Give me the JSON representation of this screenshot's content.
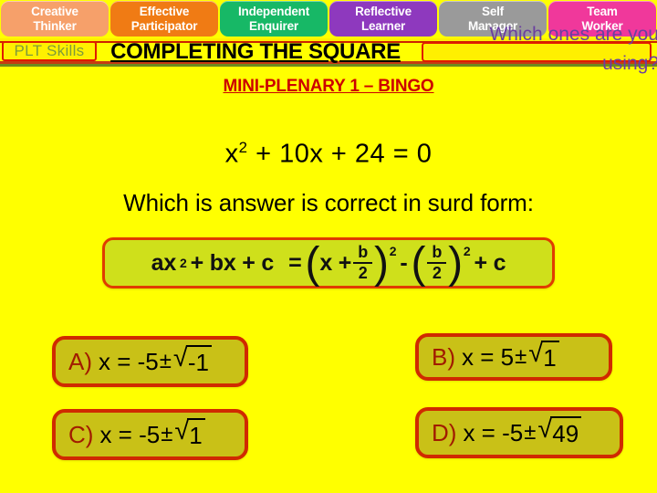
{
  "plt_bar": {
    "tabs": [
      {
        "label_line1": "Creative",
        "label_line2": "Thinker",
        "color": "#F6A06A"
      },
      {
        "label_line1": "Effective",
        "label_line2": "Participator",
        "color": "#F07B14"
      },
      {
        "label_line1": "Independent",
        "label_line2": "Enquirer",
        "color": "#17B866"
      },
      {
        "label_line1": "Reflective",
        "label_line2": "Learner",
        "color": "#8E39BE"
      },
      {
        "label_line1": "Self",
        "label_line2": "Manager",
        "color": "#9A9A9A"
      },
      {
        "label_line1": "Team",
        "label_line2": "Worker",
        "color": "#F0389B"
      }
    ]
  },
  "plt_skills": {
    "label": "PLT Skills",
    "border_color": "#E01B00",
    "text_color": "#7E9B3A"
  },
  "header": {
    "title": "COMPLETING THE SQUARE",
    "prompt": "Which ones are you using?",
    "prompt_color": "#6B3FA0"
  },
  "mini_plenary": {
    "heading": "MINI-PLENARY 1 – BINGO",
    "color": "#CC0000"
  },
  "body": {
    "equation": {
      "base": "x",
      "exponent": "2",
      "rest": " + 10x + 24 = 0"
    },
    "question": "Which is answer is correct in surd form:"
  },
  "formula": {
    "lhs": "ax",
    "lhs_exp": "2",
    "lhs_rest": " + bx + c",
    "equals": "=",
    "paren_open": "(",
    "paren_close": ")",
    "inner_x": "x +",
    "frac_num": "b",
    "frac_den": "2",
    "sup1": "2",
    "minus": "-",
    "sup2": "2",
    "plus_c": "+ c",
    "background": "#CFE01B",
    "border_color": "#E03C00"
  },
  "answers": [
    {
      "letter": "A)",
      "lead": "x = -5",
      "pm": "±",
      "radicand": "-1"
    },
    {
      "letter": "B)",
      "lead": "x =  5",
      "pm": "±",
      "radicand": "1"
    },
    {
      "letter": "C)",
      "lead": "x = -5",
      "pm": "±",
      "radicand": "1"
    },
    {
      "letter": "D)",
      "lead": "x = -5",
      "pm": "±",
      "radicand": "49"
    }
  ],
  "icons": {
    "radical": "radical-sign",
    "plus_minus": "plus-minus-sign"
  }
}
